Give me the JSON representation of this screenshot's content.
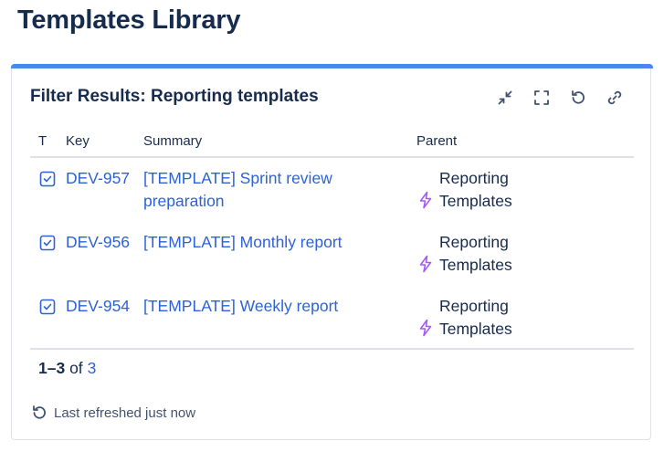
{
  "page": {
    "title": "Templates Library"
  },
  "gadget": {
    "title": "Filter Results: Reporting templates",
    "toolbar": {
      "minimize_icon": "minimize-icon",
      "fullscreen_icon": "fullscreen-icon",
      "refresh_icon": "refresh-icon",
      "link_icon": "link-icon"
    },
    "columns": {
      "type": "T",
      "key": "Key",
      "summary": "Summary",
      "parent": "Parent"
    },
    "rows": [
      {
        "type_icon": "task-checkbox-icon",
        "key": "DEV-957",
        "summary": "[TEMPLATE] Sprint review preparation",
        "parent_icon": "epic-lightning-icon",
        "parent": "Reporting Templates"
      },
      {
        "type_icon": "task-checkbox-icon",
        "key": "DEV-956",
        "summary": "[TEMPLATE] Monthly report",
        "parent_icon": "epic-lightning-icon",
        "parent": "Reporting Templates"
      },
      {
        "type_icon": "task-checkbox-icon",
        "key": "DEV-954",
        "summary": "[TEMPLATE] Weekly report",
        "parent_icon": "epic-lightning-icon",
        "parent": "Reporting Templates"
      }
    ],
    "pagination": {
      "range": "1–3",
      "of": "of",
      "total": "3"
    },
    "status": {
      "icon": "refresh-icon",
      "text": "Last refreshed just now"
    }
  },
  "colors": {
    "accent_bar": "#4c86ef",
    "link": "#2d62d6",
    "epic": "#a35cf5",
    "text": "#172b4d"
  }
}
